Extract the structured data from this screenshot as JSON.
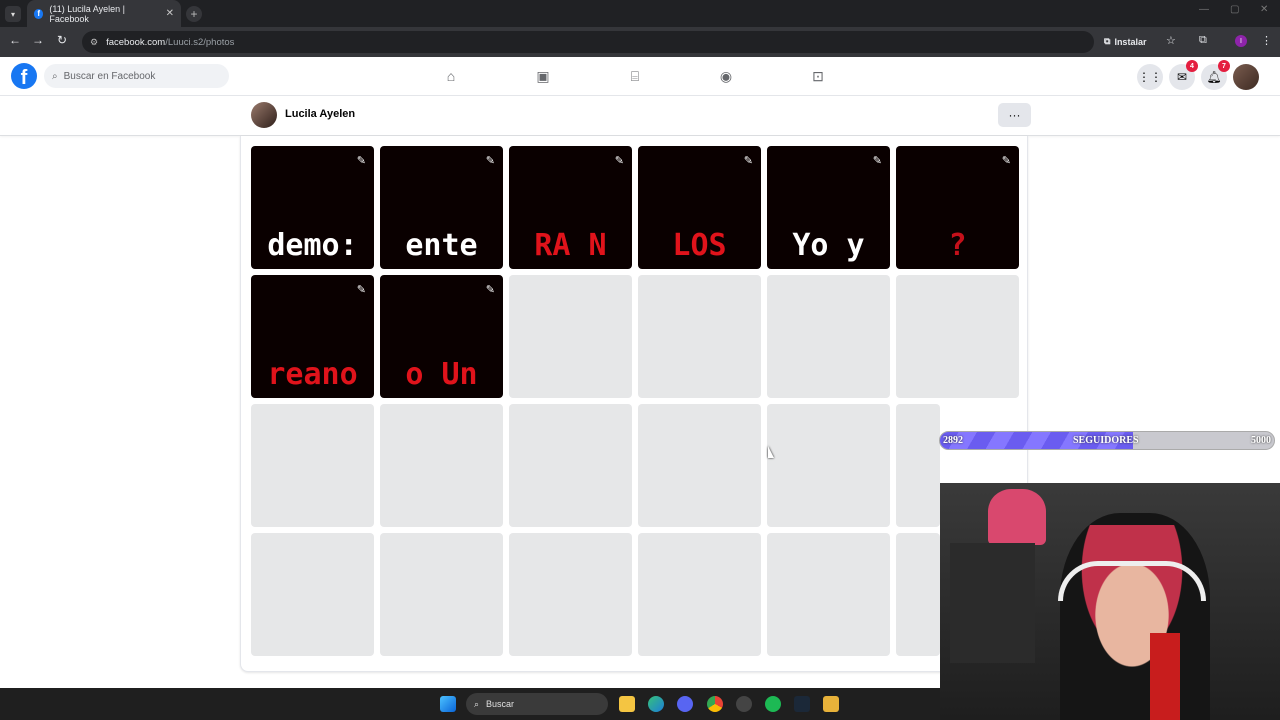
{
  "browser": {
    "tab_title": "(11) Lucila Ayelen | Facebook",
    "tab_favicon": "f",
    "address_host": "facebook.com",
    "address_path": "/Luuci.s2/photos",
    "install_label": "Instalar",
    "profile_initial": "I"
  },
  "facebook": {
    "logo": "f",
    "search_placeholder": "Buscar en Facebook",
    "nav_icons": [
      "home-icon",
      "video-icon",
      "marketplace-icon",
      "groups-icon",
      "gaming-icon"
    ],
    "messenger_badge": "4",
    "notifications_badge": "7",
    "profile_name": "Lucila Ayelen",
    "more_label": "···"
  },
  "photos": [
    {
      "text": "demo:",
      "color": "#ffffff"
    },
    {
      "text": "ente",
      "color": "#ffffff"
    },
    {
      "text": "RA N",
      "color": "#e0131b"
    },
    {
      "text": "LOS",
      "color": "#e0131b"
    },
    {
      "text": "Yo y",
      "color": "#ffffff"
    },
    {
      "text": "?",
      "color": "#c4101a"
    },
    {
      "text": "reano",
      "color": "#e0131b"
    },
    {
      "text": "o Un",
      "color": "#e0131b"
    }
  ],
  "follower_bar": {
    "current": "2892",
    "label": "SEGUIDORES",
    "goal": "5000",
    "progress": 0.578
  },
  "taskbar": {
    "search_label": "Buscar"
  }
}
